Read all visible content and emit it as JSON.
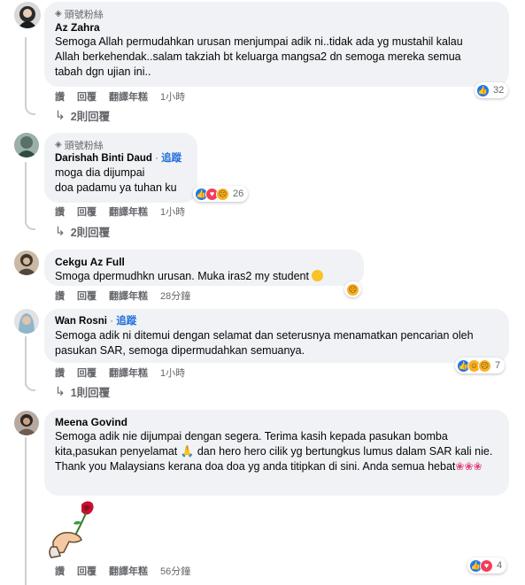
{
  "colors": {
    "bubble": "#f0f2f5",
    "link": "#216fdb",
    "muted": "#65676b",
    "like": "#1877f2",
    "love": "#f33e58"
  },
  "comments": [
    {
      "badge": "頭號粉絲",
      "author": "Az Zahra",
      "text": "Semoga Allah permudahkan urusan menjumpai adik ni..tidak ada yg mustahil kalau Allah berkehendak..salam takziah bt keluarga mangsa2 dn semoga mereka semua tabah dgn ujian ini..",
      "actions": {
        "like": "讚",
        "reply": "回覆",
        "translate": "翻譯年糕",
        "time": "1小時"
      },
      "reactions_count": "32",
      "replies_label": "2則回覆"
    },
    {
      "badge": "頭號粉絲",
      "author": "Darishah Binti Daud",
      "follow": "追蹤",
      "text_line1": "moga dia dijumpai",
      "text_line2": "doa padamu ya tuhan ku",
      "actions": {
        "like": "讚",
        "reply": "回覆",
        "translate": "翻譯年糕",
        "time": "1小時"
      },
      "reactions_count": "26",
      "replies_label": "2則回覆"
    },
    {
      "author": "Cekgu Az Full",
      "text": "Smoga dpermudhkn urusan. Muka iras2 my student",
      "actions": {
        "like": "讚",
        "reply": "回覆",
        "translate": "翻譯年糕",
        "time": "28分鐘"
      }
    },
    {
      "author": "Wan Rosni",
      "follow": "追蹤",
      "text": "Semoga adik ni ditemui dengan selamat dan seterusnya menamatkan pencarian oleh pasukan SAR, semoga dipermudahkan semuanya.",
      "actions": {
        "like": "讚",
        "reply": "回覆",
        "translate": "翻譯年糕",
        "time": "1小時"
      },
      "reactions_count": "7",
      "replies_label": "1則回覆"
    },
    {
      "author": "Meena Govind",
      "text_a": "Semoga adik nie dijumpai dengan segera. Terima kasih kepada pasukan bomba kita,pasukan penyelamat",
      "text_b": " dan hero hero cilik yg bertungkus lumus dalam SAR kali nie. Thank you Malaysians kerana doa doa yg anda titipkan di sini. Anda semua hebat",
      "actions": {
        "like": "讚",
        "reply": "回覆",
        "translate": "翻譯年糕",
        "time": "56分鐘"
      },
      "reactions_count": "4"
    }
  ]
}
